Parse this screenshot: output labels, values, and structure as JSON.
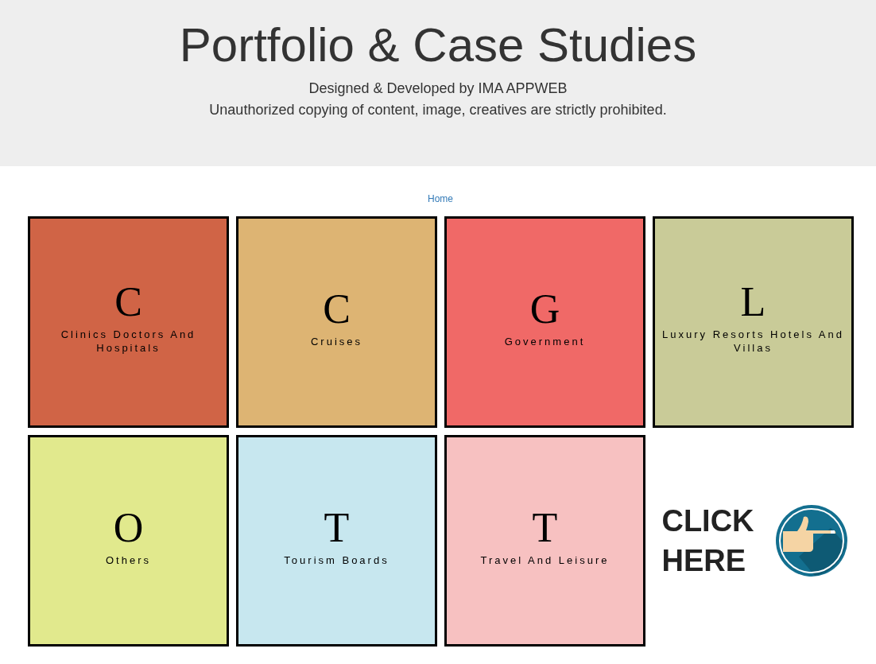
{
  "header": {
    "title": "Portfolio & Case Studies",
    "subtitle_lines": [
      "Designed & Developed by IMA APPWEB",
      "Unauthorized copying of content, image, creatives are strictly prohibited."
    ]
  },
  "breadcrumb": {
    "link": "Home"
  },
  "categories": [
    {
      "letter": "C",
      "label": "Clinics Doctors And Hospitals",
      "color": "#d06446"
    },
    {
      "letter": "C",
      "label": "Cruises",
      "color": "#ddb473"
    },
    {
      "letter": "G",
      "label": "Government",
      "color": "#f06967"
    },
    {
      "letter": "L",
      "label": "Luxury Resorts Hotels And Villas",
      "color": "#c9cb98"
    },
    {
      "letter": "O",
      "label": "Others",
      "color": "#e1e98d"
    },
    {
      "letter": "T",
      "label": "Tourism Boards",
      "color": "#c7e7ef"
    },
    {
      "letter": "T",
      "label": "Travel And Leisure",
      "color": "#f7c1c1"
    }
  ],
  "click_here": {
    "lines": [
      "CLICK",
      "HERE"
    ]
  }
}
